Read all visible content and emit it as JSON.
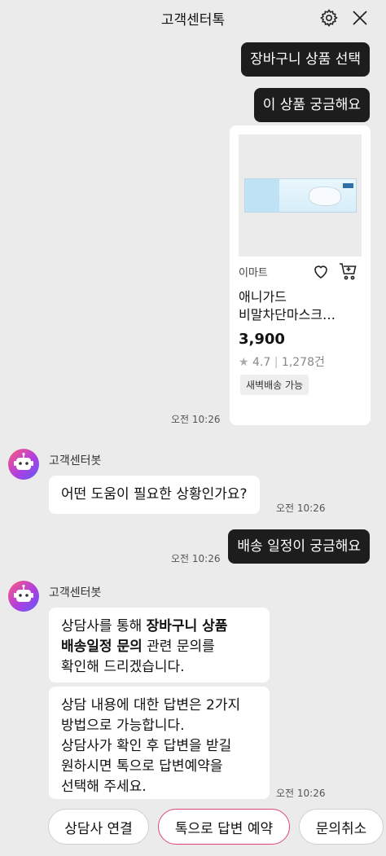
{
  "header": {
    "title": "고객센터톡",
    "settings_icon": "gear-icon",
    "close_icon": "close-icon"
  },
  "messages": {
    "user1": "장바구니 상품 선택",
    "user2": "이 상품 궁금해요",
    "user3": "배송 일정이 궁금해요",
    "time_card": "오전 10:26",
    "time_bot1": "오전 10:26",
    "time_user3": "오전 10:26",
    "time_bot2": "오전 10:26"
  },
  "product": {
    "seller": "이마트",
    "name_line1": "애니가드",
    "name_line2": "비말차단마스크…",
    "price": "3,900",
    "rating": "4.7",
    "review_count": "1,278건",
    "delivery_tag": "새벽배송 가능"
  },
  "bot": {
    "name": "고객센터봇",
    "q1": "어떤 도움이 필요한 상황인가요?",
    "msg2_part1": "상담사를 통해 ",
    "msg2_bold1": "장바구니 상품",
    "msg2_bold2": "배송일정 문의",
    "msg2_part2": " 관련 문의를",
    "msg2_part3": "확인해 드리겠습니다.",
    "msg3_line1": "상담 내용에 대한 답변은 2가지",
    "msg3_line2": "방법으로 가능합니다.",
    "msg3_line3": "상담사가 확인 후 답변을 받길",
    "msg3_line4": "원하시면 톡으로 답변예약을",
    "msg3_line5": "선택해 주세요."
  },
  "buttons": {
    "connect": "상담사 연결",
    "reserve": "톡으로 답변 예약",
    "cancel": "문의취소"
  },
  "colors": {
    "dark_bubble": "#1d1d1d",
    "background": "#ebebeb",
    "accent_border": "#e0457a"
  }
}
